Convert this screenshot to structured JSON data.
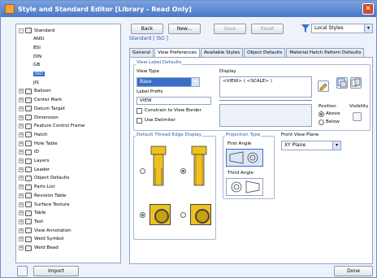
{
  "window": {
    "title": "Style and Standard Editor [Library - Read Only]"
  },
  "tree": {
    "items": [
      {
        "label": "Standard",
        "icon": "standard-icon",
        "indent": 0,
        "expander": "-"
      },
      {
        "label": "ANSI",
        "indent": 2
      },
      {
        "label": "BSI",
        "indent": 2
      },
      {
        "label": "DIN",
        "indent": 2
      },
      {
        "label": "GB",
        "indent": 2
      },
      {
        "label": "ISO",
        "indent": 2,
        "selected": true
      },
      {
        "label": "JIS",
        "indent": 2
      },
      {
        "label": "Balloon",
        "icon": "balloon-icon",
        "indent": 0,
        "expander": "+"
      },
      {
        "label": "Center Mark",
        "icon": "center-mark-icon",
        "indent": 0,
        "expander": "+"
      },
      {
        "label": "Datum Target",
        "icon": "datum-target-icon",
        "indent": 0,
        "expander": "+"
      },
      {
        "label": "Dimension",
        "icon": "dimension-icon",
        "indent": 0,
        "expander": "+"
      },
      {
        "label": "Feature Control Frame",
        "icon": "feature-control-frame-icon",
        "indent": 0,
        "expander": "+"
      },
      {
        "label": "Hatch",
        "icon": "hatch-icon",
        "indent": 0,
        "expander": "+"
      },
      {
        "label": "Hole Table",
        "icon": "hole-table-icon",
        "indent": 0,
        "expander": "+"
      },
      {
        "label": "ID",
        "icon": "id-icon",
        "indent": 0,
        "expander": "+"
      },
      {
        "label": "Layers",
        "icon": "layers-icon",
        "indent": 0,
        "expander": "+"
      },
      {
        "label": "Leader",
        "icon": "leader-icon",
        "indent": 0,
        "expander": "+"
      },
      {
        "label": "Object Defaults",
        "icon": "object-defaults-icon",
        "indent": 0,
        "expander": "+"
      },
      {
        "label": "Parts List",
        "icon": "parts-list-icon",
        "indent": 0,
        "expander": "+"
      },
      {
        "label": "Revision Table",
        "icon": "revision-table-icon",
        "indent": 0,
        "expander": "+"
      },
      {
        "label": "Surface Texture",
        "icon": "surface-texture-icon",
        "indent": 0,
        "expander": "+"
      },
      {
        "label": "Table",
        "icon": "table-icon",
        "indent": 0,
        "expander": "+"
      },
      {
        "label": "Text",
        "icon": "text-icon",
        "indent": 0,
        "expander": "+"
      },
      {
        "label": "View Annotation",
        "icon": "view-annotation-icon",
        "indent": 0,
        "expander": "+"
      },
      {
        "label": "Weld Symbol",
        "icon": "weld-symbol-icon",
        "indent": 0,
        "expander": "+"
      },
      {
        "label": "Weld Bead",
        "icon": "weld-bead-icon",
        "indent": 0,
        "expander": "+"
      }
    ]
  },
  "toolbar": {
    "back": "Back",
    "new": "New...",
    "save": "Save",
    "reset": "Reset",
    "filter_icon": "filter-icon",
    "styles_select": "Local Styles"
  },
  "breadcrumb": "Standard [ ISO ]",
  "tabs": [
    "General",
    "View Preferences",
    "Available Styles",
    "Object Defaults",
    "Material Hatch Pattern Defaults"
  ],
  "active_tab": "View Preferences",
  "view_label": {
    "group": "View Label Defaults",
    "view_type_label": "View Type",
    "view_type_value": "Base",
    "label_prefix_label": "Label Prefix",
    "label_prefix_value": "VIEW",
    "constrain": "Constrain to View Border",
    "delimiter": "Use Delimiter",
    "display_label": "Display",
    "display_value": "<VIEW> ( <SCALE> )",
    "position_label": "Position",
    "above": "Above",
    "below": "Below",
    "visibility_label": "Visibility"
  },
  "thread": {
    "group": "Default Thread Edge Display"
  },
  "projection": {
    "group": "Projection Type",
    "first": "First Angle",
    "third": "Third Angle"
  },
  "front_plane": {
    "label": "Front View Plane",
    "value": "XY Plane"
  },
  "footer": {
    "import": "Import",
    "done": "Done"
  },
  "colors": {
    "title_bar": "#4a78c8",
    "selection": "#3a6ec8",
    "accent_text": "#2b5aa8",
    "nut_yellow": "#f0c020"
  }
}
